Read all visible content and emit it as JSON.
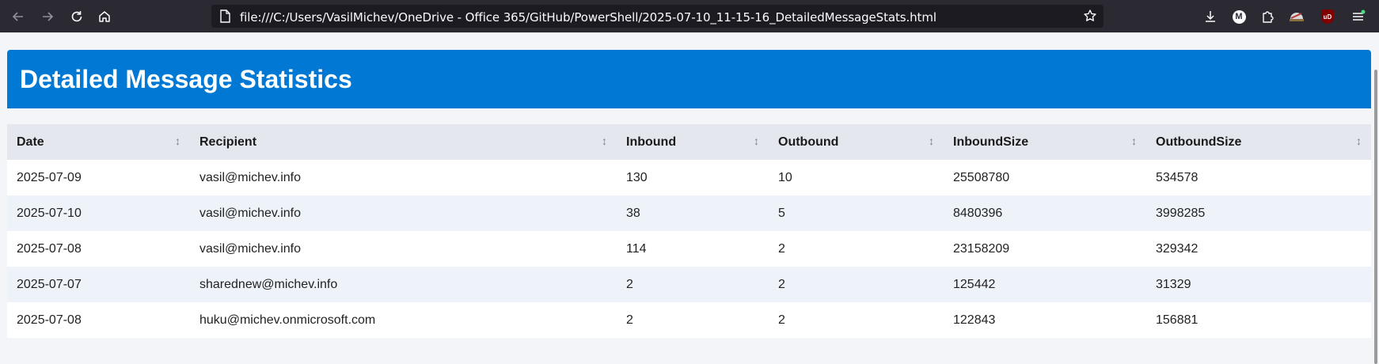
{
  "browser": {
    "url": "file:///C:/Users/VasilMichev/OneDrive - Office 365/GitHub/PowerShell/2025-07-10_11-15-16_DetailedMessageStats.html",
    "icons": [
      "back-icon",
      "forward-icon",
      "reload-icon",
      "home-icon",
      "page-icon",
      "bookmark-star-icon",
      "downloads-icon",
      "extension-m-icon",
      "extensions-puzzle-icon",
      "extension-helmet-icon",
      "ublock-icon",
      "menu-icon"
    ],
    "m_badge": "M",
    "ublock_badge": "uD"
  },
  "page": {
    "title": "Detailed Message Statistics",
    "accent_color": "#0078d4"
  },
  "table": {
    "columns": [
      "Date",
      "Recipient",
      "Inbound",
      "Outbound",
      "InboundSize",
      "OutboundSize"
    ],
    "rows": [
      [
        "2025-07-09",
        "vasil@michev.info",
        "130",
        "10",
        "25508780",
        "534578"
      ],
      [
        "2025-07-10",
        "vasil@michev.info",
        "38",
        "5",
        "8480396",
        "3998285"
      ],
      [
        "2025-07-08",
        "vasil@michev.info",
        "114",
        "2",
        "23158209",
        "329342"
      ],
      [
        "2025-07-07",
        "sharednew@michev.info",
        "2",
        "2",
        "125442",
        "31329"
      ],
      [
        "2025-07-08",
        "huku@michev.onmicrosoft.com",
        "2",
        "2",
        "122843",
        "156881"
      ]
    ]
  }
}
